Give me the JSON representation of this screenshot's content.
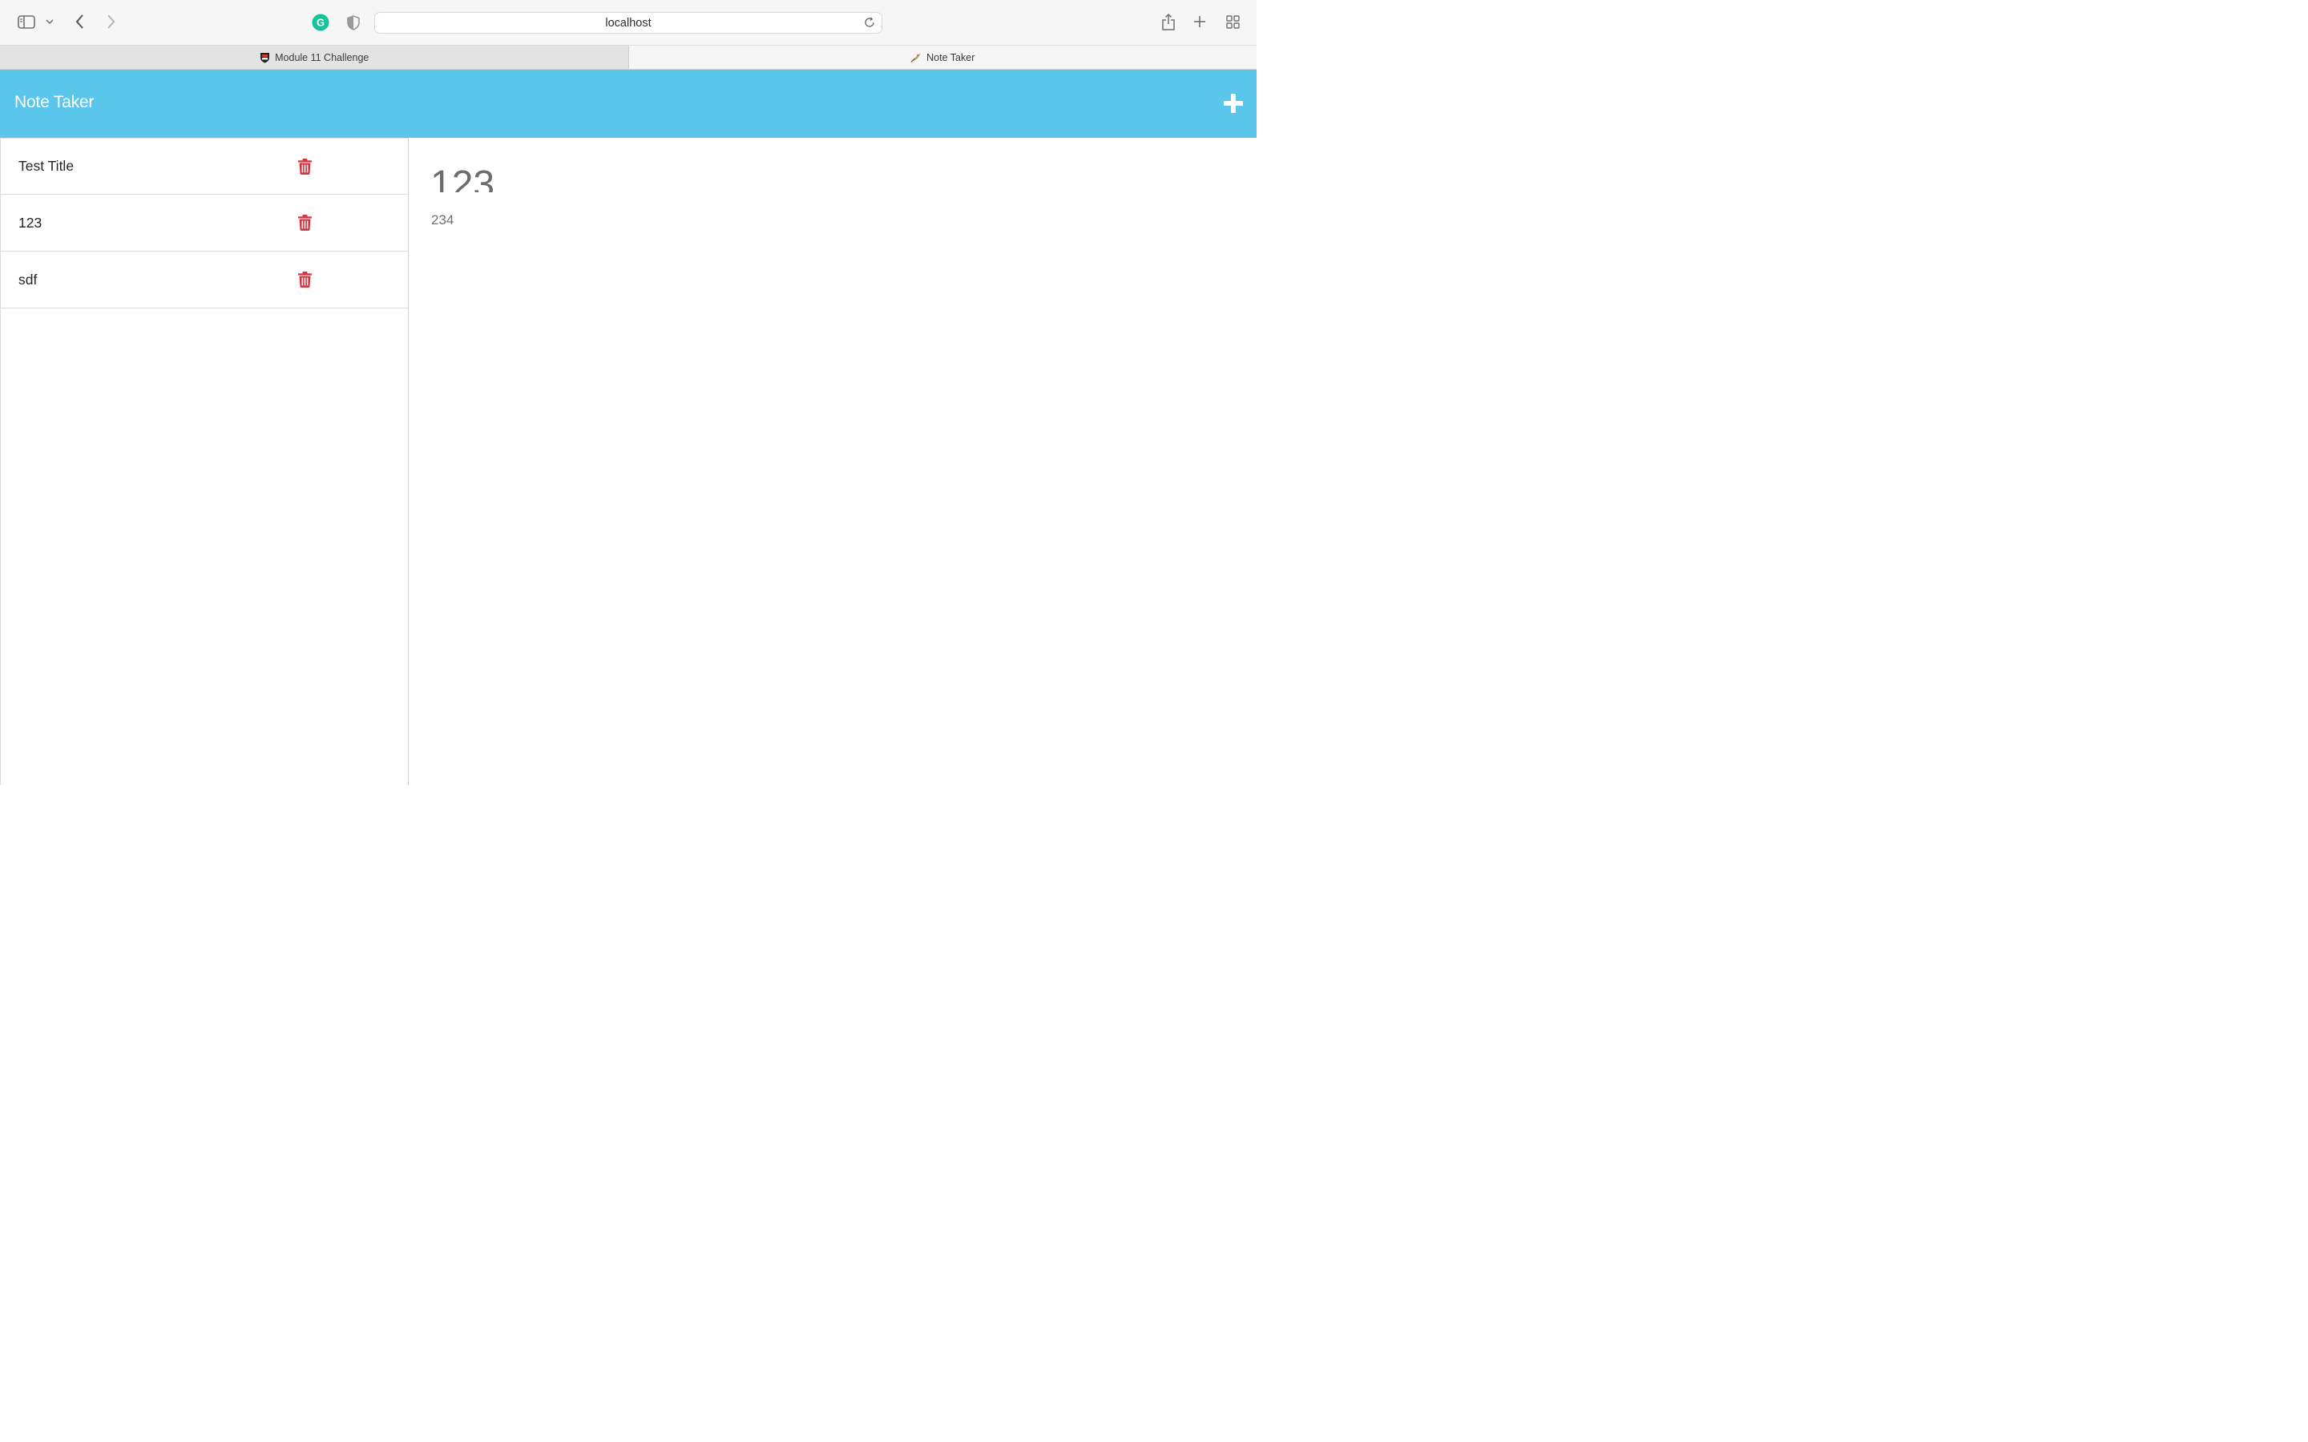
{
  "browser": {
    "url": "localhost",
    "tabs": [
      {
        "label": "Module 11 Challenge",
        "active": false
      },
      {
        "label": "Note Taker",
        "active": true
      }
    ]
  },
  "app": {
    "title": "Note Taker",
    "new_note_icon": "plus-icon",
    "accent_color": "#5bc6ec",
    "delete_color": "#cc3a45"
  },
  "notes": [
    {
      "title": "Test Title"
    },
    {
      "title": "123"
    },
    {
      "title": "sdf"
    }
  ],
  "active_note": {
    "title": "123",
    "text": "234"
  }
}
